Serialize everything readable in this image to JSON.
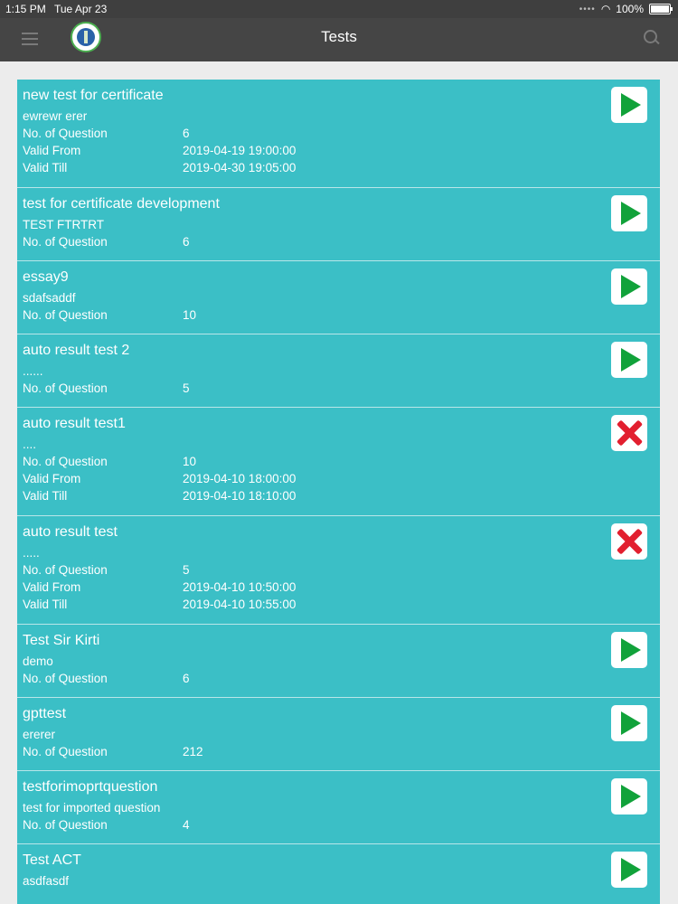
{
  "status_bar": {
    "time": "1:15 PM",
    "date": "Tue Apr 23",
    "battery": "100%"
  },
  "header": {
    "title": "Tests"
  },
  "labels": {
    "questions": "No. of Question",
    "valid_from": "Valid From",
    "valid_till": "Valid Till"
  },
  "tests": [
    {
      "title": "new test for certificate",
      "desc": "ewrewr erer",
      "questions": "6",
      "valid_from": "2019-04-19 19:00:00",
      "valid_till": "2019-04-30 19:05:00",
      "action": "start"
    },
    {
      "title": "test for certificate development",
      "desc": "TEST FTRTRT",
      "questions": "6",
      "action": "start"
    },
    {
      "title": "essay9",
      "desc": "sdafsaddf",
      "questions": "10",
      "action": "start"
    },
    {
      "title": "auto result test 2",
      "desc": "......",
      "questions": "5",
      "action": "start"
    },
    {
      "title": "auto result test1",
      "desc": "....",
      "questions": "10",
      "valid_from": "2019-04-10 18:00:00",
      "valid_till": "2019-04-10 18:10:00",
      "action": "unavailable"
    },
    {
      "title": "auto result test",
      "desc": ".....",
      "questions": "5",
      "valid_from": "2019-04-10 10:50:00",
      "valid_till": "2019-04-10 10:55:00",
      "action": "unavailable"
    },
    {
      "title": "Test Sir Kirti",
      "desc": "demo",
      "questions": "6",
      "action": "start"
    },
    {
      "title": "gpttest",
      "desc": "ererer",
      "questions": "212",
      "action": "start"
    },
    {
      "title": "testforimoprtquestion",
      "desc": "test for imported question",
      "questions": "4",
      "action": "start"
    },
    {
      "title": " Test ACT",
      "desc": "asdfasdf",
      "action": "start"
    }
  ],
  "colors": {
    "card": "#3bbfc6",
    "navbar": "#454545",
    "play": "#11a23a",
    "cross": "#e21f2f"
  }
}
